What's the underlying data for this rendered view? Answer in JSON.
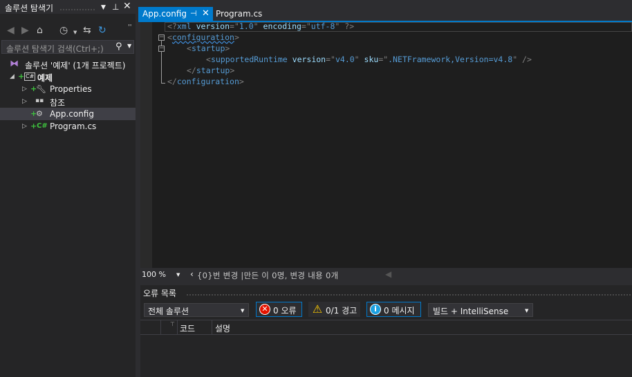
{
  "solution_explorer": {
    "title": "솔루션 탐색기",
    "search_placeholder": "솔루션 탐색기 검색(Ctrl+;)",
    "tree": {
      "solution": "솔루션 '예제' (1개 프로젝트)",
      "project": "예제",
      "properties": "Properties",
      "references": "참조",
      "app_config": "App.config",
      "program_cs": "Program.cs"
    }
  },
  "editor": {
    "tabs": [
      {
        "label": "App.config",
        "active": true
      },
      {
        "label": "Program.cs",
        "active": false
      }
    ],
    "code": {
      "line1": {
        "open": "<?",
        "tag": "xml",
        "a1": " version",
        "eq1": "=\"",
        "v1": "1.0",
        "q1": "\"",
        "a2": " encoding",
        "eq2": "=\"",
        "v2": "utf-8",
        "q2": "\"",
        "close": " ?>"
      },
      "line2": {
        "open": "<",
        "tag": "configuration",
        "close": ">"
      },
      "line3": {
        "open": "<",
        "tag": "startup",
        "close": ">"
      },
      "line4": {
        "open": "<",
        "tag": "supportedRuntime",
        "a1": " version",
        "eq1": "=\"",
        "v1": "v4.0",
        "q1": "\"",
        "a2": " sku",
        "eq2": "=\"",
        "v2": ".NETFramework,Version=v4.8",
        "q2": "\"",
        "close": " />"
      },
      "line5": {
        "open": "</",
        "tag": "startup",
        "close": ">"
      },
      "line6": {
        "open": "</",
        "tag": "configuration",
        "close": ">"
      }
    },
    "zoom": "100 %",
    "changes_text": "{0}번 변경 |만든 이 0명, 변경 내용 0개"
  },
  "error_list": {
    "title": "오류 목록",
    "scope": "전체 솔루션",
    "errors": "0 오류",
    "warnings": "0/1 경고",
    "messages": "0 메시지",
    "build_filter": "빌드 + IntelliSense",
    "columns": {
      "code": "코드",
      "description": "설명"
    }
  }
}
